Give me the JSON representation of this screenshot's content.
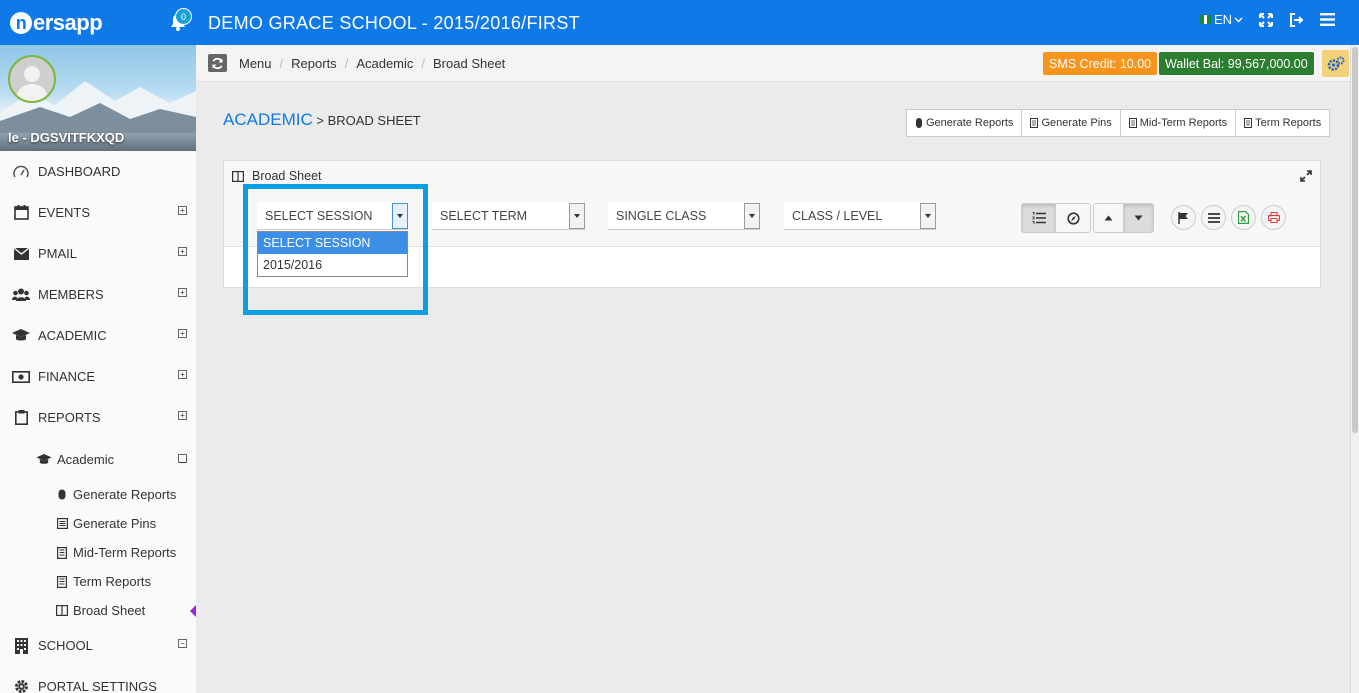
{
  "header": {
    "logo_text": "ersapp",
    "logo_letter": "n",
    "notifications_count": "0",
    "app_title": "DEMO GRACE SCHOOL - 2015/2016/FIRST",
    "language": "EN",
    "colors": {
      "bar": "#1079e8"
    }
  },
  "profile": {
    "name": "le - DGSVITFKXQD"
  },
  "sidebar": {
    "items": [
      {
        "label": "DASHBOARD",
        "icon": "dashboard-icon",
        "toggle": ""
      },
      {
        "label": "EVENTS",
        "icon": "calendar-icon",
        "toggle": "⊞"
      },
      {
        "label": "PMAIL",
        "icon": "mail-icon",
        "toggle": "⊞"
      },
      {
        "label": "MEMBERS",
        "icon": "users-icon",
        "toggle": "⊞"
      },
      {
        "label": "ACADEMIC",
        "icon": "graduation-cap-icon",
        "toggle": "⊞"
      },
      {
        "label": "FINANCE",
        "icon": "money-icon",
        "toggle": "⊞"
      },
      {
        "label": "REPORTS",
        "icon": "clipboard-icon",
        "toggle": "⊟"
      }
    ],
    "sub_group": {
      "label": "Academic",
      "icon": "graduation-cap-icon",
      "toggle": "⊟"
    },
    "sub_items": [
      {
        "label": "Generate Reports",
        "icon": "mouse-icon"
      },
      {
        "label": "Generate Pins",
        "icon": "list-icon"
      },
      {
        "label": "Mid-Term Reports",
        "icon": "document-icon"
      },
      {
        "label": "Term Reports",
        "icon": "document-icon"
      },
      {
        "label": "Broad Sheet",
        "icon": "columns-icon"
      }
    ],
    "bottom_items": [
      {
        "label": "SCHOOL",
        "icon": "building-icon",
        "toggle": "⊞"
      },
      {
        "label": "PORTAL SETTINGS",
        "icon": "gear-icon",
        "toggle": ""
      }
    ]
  },
  "breadcrumb": {
    "items": [
      "Menu",
      "Reports",
      "Academic",
      "Broad Sheet"
    ]
  },
  "badges": {
    "sms": "SMS Credit: 10.00",
    "wallet": "Wallet Bal: 99,567,000.00"
  },
  "page": {
    "heading_main": "ACADEMIC",
    "heading_sep": " > ",
    "heading_sub": "BROAD SHEET",
    "actions": [
      "Generate Reports",
      "Generate Pins",
      "Mid-Term Reports",
      "Term Reports"
    ]
  },
  "panel": {
    "title": "Broad Sheet",
    "selects": [
      {
        "value": "SELECT SESSION",
        "open": true
      },
      {
        "value": "SELECT TERM"
      },
      {
        "value": "SINGLE CLASS"
      },
      {
        "value": "CLASS / LEVEL"
      }
    ],
    "session_options": [
      "SELECT SESSION",
      "2015/2016"
    ]
  }
}
